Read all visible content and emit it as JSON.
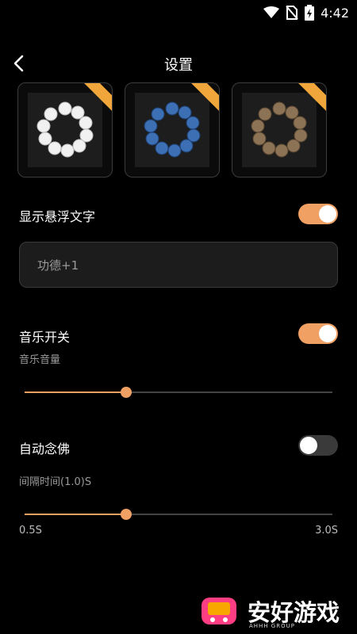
{
  "status_bar": {
    "time": "4:42"
  },
  "header": {
    "title": "设置"
  },
  "bead_options": [
    {
      "name": "white-bead-bracelet",
      "color": "#f1f1f1"
    },
    {
      "name": "blue-bead-bracelet",
      "color": "#3d6fb4"
    },
    {
      "name": "wood-bead-bracelet",
      "color": "#8d7355"
    }
  ],
  "floating_text": {
    "label": "显示悬浮文字",
    "enabled": true,
    "input_value": "功德+1"
  },
  "music": {
    "label": "音乐开关",
    "enabled": true,
    "volume_label": "音乐音量",
    "volume": 0.33
  },
  "auto_chant": {
    "label": "自动念佛",
    "enabled": false,
    "interval_label": "间隔时间(1.0)S",
    "interval_value": 0.33,
    "min_label": "0.5S",
    "max_label": "3.0S"
  },
  "watermark": {
    "brand_text": "安好游戏",
    "sub_text": "AHHH GROUP"
  },
  "colors": {
    "accent": "#f0a063",
    "background": "#000000"
  }
}
